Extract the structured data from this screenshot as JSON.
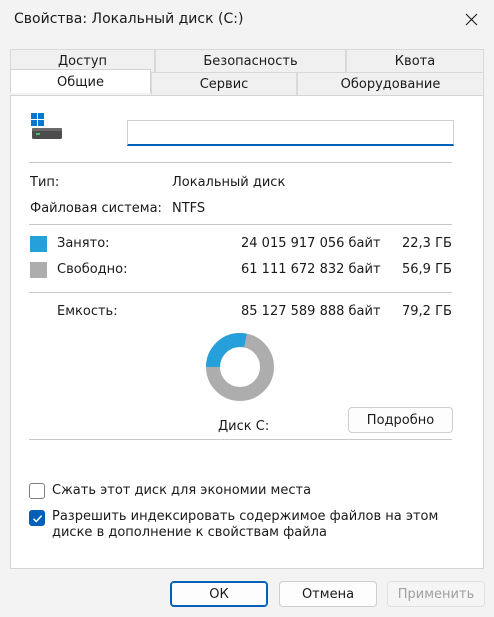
{
  "window": {
    "title": "Свойства: Локальный диск (C:)"
  },
  "tabs": {
    "row1": [
      "Доступ",
      "Безопасность",
      "Квота"
    ],
    "row2": [
      "Общие",
      "Сервис",
      "Оборудование"
    ],
    "active": "Общие"
  },
  "general": {
    "name_value": "",
    "type_label": "Тип:",
    "type_value": "Локальный диск",
    "fs_label": "Файловая система:",
    "fs_value": "NTFS",
    "used": {
      "label": "Занято:",
      "bytes": "24 015 917 056 байт",
      "size": "22,3 ГБ",
      "color": "#26a0da"
    },
    "free": {
      "label": "Свободно:",
      "bytes": "61 111 672 832 байт",
      "size": "56,9 ГБ",
      "color": "#adadad"
    },
    "capacity": {
      "label": "Емкость:",
      "bytes": "85 127 589 888 байт",
      "size": "79,2 ГБ"
    },
    "usage_fraction": 0.282,
    "disk_label": "Диск C:",
    "details_button": "Подробно",
    "compress": {
      "label": "Сжать этот диск для экономии места",
      "checked": false
    },
    "index": {
      "line1": "Разрешить индексировать содержимое файлов на этом",
      "line2": "диске в дополнение к свойствам файла",
      "checked": true
    }
  },
  "footer": {
    "ok": "ОК",
    "cancel": "Отмена",
    "apply": "Применить"
  },
  "icons": {
    "close": "close-icon",
    "drive": "drive-icon",
    "check": "checkmark-icon"
  }
}
